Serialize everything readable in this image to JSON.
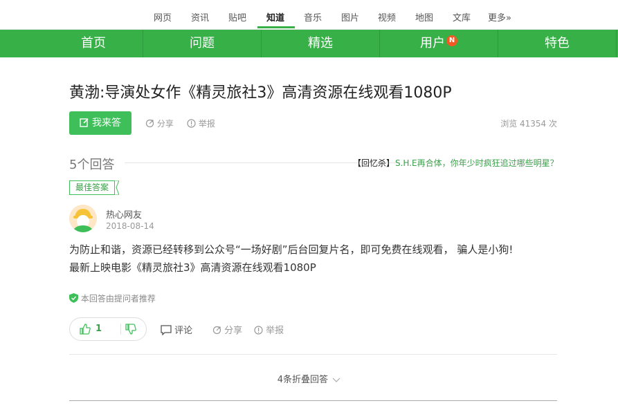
{
  "topnav": {
    "items": [
      "网页",
      "资讯",
      "贴吧",
      "知道",
      "音乐",
      "图片",
      "视频",
      "地图",
      "文库",
      "更多»"
    ],
    "active": "知道"
  },
  "greenbar": {
    "tabs": [
      "首页",
      "问题",
      "精选",
      "用户",
      "特色"
    ],
    "badge": "N"
  },
  "question": {
    "title": "黄渤:导演处女作《精灵旅社3》高清资源在线观看1080P",
    "answer_button": "我来答",
    "share": "分享",
    "report": "举报",
    "views": "浏览 41354 次"
  },
  "answers": {
    "count_label": "5个回答",
    "promo_tag": "【回忆杀】",
    "promo_link": "S.H.E再合体，你年少时疯狂追过哪些明星？"
  },
  "best_answer": {
    "tag": "最佳答案",
    "user": "热心网友",
    "date": "2018-08-14",
    "content_line1": "为防止和谐，资源已经转移到公众号“一场好剧”后台回复片名，即可免费在线观看， 骗人是小狗!",
    "content_line2": "最新上映电影《精灵旅社3》高清资源在线观看1080P",
    "recommend": "本回答由提问者推荐",
    "likes": "1",
    "comment": "评论",
    "share": "分享",
    "report": "举报"
  },
  "folded": "4条折叠回答",
  "colors": {
    "brand_green": "#38b048",
    "badge_orange": "#f15a23"
  }
}
